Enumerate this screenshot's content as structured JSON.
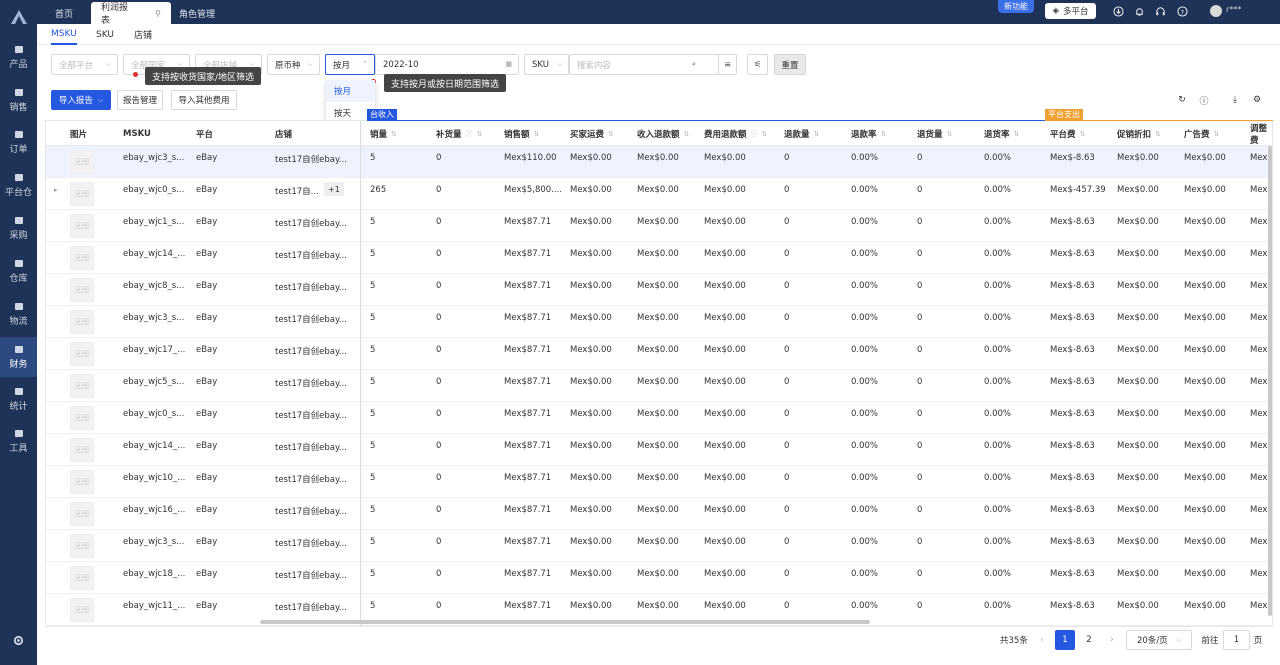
{
  "topbar": {
    "tabs": [
      {
        "label": "首页"
      },
      {
        "label": "利润报表"
      },
      {
        "label": "角色管理"
      }
    ],
    "new_feature": "新功能",
    "multi_platform": "多平台",
    "username": "r***"
  },
  "sidebar": {
    "items": [
      {
        "label": "产品",
        "icon": "product-icon"
      },
      {
        "label": "销售",
        "icon": "sales-icon"
      },
      {
        "label": "订单",
        "icon": "order-icon"
      },
      {
        "label": "平台仓",
        "icon": "platform-warehouse-icon"
      },
      {
        "label": "采购",
        "icon": "purchase-icon"
      },
      {
        "label": "仓库",
        "icon": "warehouse-icon"
      },
      {
        "label": "物流",
        "icon": "logistics-icon"
      },
      {
        "label": "财务",
        "icon": "finance-icon",
        "active": true
      },
      {
        "label": "统计",
        "icon": "stats-icon"
      },
      {
        "label": "工具",
        "icon": "tools-icon"
      }
    ]
  },
  "subtabs": [
    "MSKU",
    "SKU",
    "店铺"
  ],
  "filters": {
    "platform_placeholder": "全部平台",
    "country_placeholder": "全部国家",
    "store_placeholder": "全部店铺",
    "currency": "原币种",
    "period_type": "按月",
    "date": "2022-10",
    "search_type": "SKU",
    "search_placeholder": "搜索内容",
    "reset": "重置"
  },
  "tooltips": {
    "country": "支持按收货国家/地区筛选",
    "period": "支持按月或按日期范围筛选"
  },
  "period_options": [
    "按月",
    "按天"
  ],
  "actions": {
    "import_report": "导入报告",
    "report_manage": "报告管理",
    "import_other": "导入其他费用"
  },
  "groups": {
    "income": "台收入",
    "expense": "平台支出"
  },
  "columns": {
    "image": "图片",
    "msku": "MSKU",
    "platform": "平台",
    "store": "店铺",
    "sales_qty": "销量",
    "restock": "补货量",
    "sales_amount": "销售额",
    "buyer_shipping": "买家运费",
    "income_refund": "收入退款额",
    "fee_refund": "费用退款额",
    "refund_qty": "退款量",
    "refund_rate": "退款率",
    "return_qty": "退货量",
    "return_rate": "退货率",
    "platform_fee": "平台费",
    "promo_discount": "促销折扣",
    "ad_fee": "广告费",
    "adjust_fee": "调整费"
  },
  "no_image": "无图",
  "rows": [
    {
      "msku": "ebay_wjc3_s...",
      "platform": "eBay",
      "store": "test17自创ebay...",
      "sales": "5",
      "restock": "0",
      "amount": "Mex$110.00",
      "ship": "Mex$0.00",
      "inref": "Mex$0.00",
      "feeref": "Mex$0.00",
      "rqty": "0",
      "rrate": "0.00%",
      "retq": "0",
      "retr": "0.00%",
      "pfee": "Mex$-8.63",
      "promo": "Mex$0.00",
      "ad": "Mex$0.00",
      "adj": "Mex"
    },
    {
      "msku": "ebay_wjc0_s...",
      "platform": "eBay",
      "store": "test17自...",
      "badge": "+1",
      "sales": "265",
      "restock": "0",
      "amount": "Mex$5,800....",
      "ship": "Mex$0.00",
      "inref": "Mex$0.00",
      "feeref": "Mex$0.00",
      "rqty": "0",
      "rrate": "0.00%",
      "retq": "0",
      "retr": "0.00%",
      "pfee": "Mex$-457.39",
      "promo": "Mex$0.00",
      "ad": "Mex$0.00",
      "adj": "Mex"
    },
    {
      "msku": "ebay_wjc1_s...",
      "platform": "eBay",
      "store": "test17自创ebay...",
      "sales": "5",
      "restock": "0",
      "amount": "Mex$87.71",
      "ship": "Mex$0.00",
      "inref": "Mex$0.00",
      "feeref": "Mex$0.00",
      "rqty": "0",
      "rrate": "0.00%",
      "retq": "0",
      "retr": "0.00%",
      "pfee": "Mex$-8.63",
      "promo": "Mex$0.00",
      "ad": "Mex$0.00",
      "adj": "Mex"
    },
    {
      "msku": "ebay_wjc14_...",
      "platform": "eBay",
      "store": "test17自创ebay...",
      "sales": "5",
      "restock": "0",
      "amount": "Mex$87.71",
      "ship": "Mex$0.00",
      "inref": "Mex$0.00",
      "feeref": "Mex$0.00",
      "rqty": "0",
      "rrate": "0.00%",
      "retq": "0",
      "retr": "0.00%",
      "pfee": "Mex$-8.63",
      "promo": "Mex$0.00",
      "ad": "Mex$0.00",
      "adj": "Mex"
    },
    {
      "msku": "ebay_wjc8_s...",
      "platform": "eBay",
      "store": "test17自创ebay...",
      "sales": "5",
      "restock": "0",
      "amount": "Mex$87.71",
      "ship": "Mex$0.00",
      "inref": "Mex$0.00",
      "feeref": "Mex$0.00",
      "rqty": "0",
      "rrate": "0.00%",
      "retq": "0",
      "retr": "0.00%",
      "pfee": "Mex$-8.63",
      "promo": "Mex$0.00",
      "ad": "Mex$0.00",
      "adj": "Mex"
    },
    {
      "msku": "ebay_wjc3_s...",
      "platform": "eBay",
      "store": "test17自创ebay...",
      "sales": "5",
      "restock": "0",
      "amount": "Mex$87.71",
      "ship": "Mex$0.00",
      "inref": "Mex$0.00",
      "feeref": "Mex$0.00",
      "rqty": "0",
      "rrate": "0.00%",
      "retq": "0",
      "retr": "0.00%",
      "pfee": "Mex$-8.63",
      "promo": "Mex$0.00",
      "ad": "Mex$0.00",
      "adj": "Mex"
    },
    {
      "msku": "ebay_wjc17_...",
      "platform": "eBay",
      "store": "test17自创ebay...",
      "sales": "5",
      "restock": "0",
      "amount": "Mex$87.71",
      "ship": "Mex$0.00",
      "inref": "Mex$0.00",
      "feeref": "Mex$0.00",
      "rqty": "0",
      "rrate": "0.00%",
      "retq": "0",
      "retr": "0.00%",
      "pfee": "Mex$-8.63",
      "promo": "Mex$0.00",
      "ad": "Mex$0.00",
      "adj": "Mex"
    },
    {
      "msku": "ebay_wjc5_s...",
      "platform": "eBay",
      "store": "test17自创ebay...",
      "sales": "5",
      "restock": "0",
      "amount": "Mex$87.71",
      "ship": "Mex$0.00",
      "inref": "Mex$0.00",
      "feeref": "Mex$0.00",
      "rqty": "0",
      "rrate": "0.00%",
      "retq": "0",
      "retr": "0.00%",
      "pfee": "Mex$-8.63",
      "promo": "Mex$0.00",
      "ad": "Mex$0.00",
      "adj": "Mex"
    },
    {
      "msku": "ebay_wjc0_s...",
      "platform": "eBay",
      "store": "test17自创ebay...",
      "sales": "5",
      "restock": "0",
      "amount": "Mex$87.71",
      "ship": "Mex$0.00",
      "inref": "Mex$0.00",
      "feeref": "Mex$0.00",
      "rqty": "0",
      "rrate": "0.00%",
      "retq": "0",
      "retr": "0.00%",
      "pfee": "Mex$-8.63",
      "promo": "Mex$0.00",
      "ad": "Mex$0.00",
      "adj": "Mex"
    },
    {
      "msku": "ebay_wjc14_...",
      "platform": "eBay",
      "store": "test17自创ebay...",
      "sales": "5",
      "restock": "0",
      "amount": "Mex$87.71",
      "ship": "Mex$0.00",
      "inref": "Mex$0.00",
      "feeref": "Mex$0.00",
      "rqty": "0",
      "rrate": "0.00%",
      "retq": "0",
      "retr": "0.00%",
      "pfee": "Mex$-8.63",
      "promo": "Mex$0.00",
      "ad": "Mex$0.00",
      "adj": "Mex"
    },
    {
      "msku": "ebay_wjc10_...",
      "platform": "eBay",
      "store": "test17自创ebay...",
      "sales": "5",
      "restock": "0",
      "amount": "Mex$87.71",
      "ship": "Mex$0.00",
      "inref": "Mex$0.00",
      "feeref": "Mex$0.00",
      "rqty": "0",
      "rrate": "0.00%",
      "retq": "0",
      "retr": "0.00%",
      "pfee": "Mex$-8.63",
      "promo": "Mex$0.00",
      "ad": "Mex$0.00",
      "adj": "Mex"
    },
    {
      "msku": "ebay_wjc16_...",
      "platform": "eBay",
      "store": "test17自创ebay...",
      "sales": "5",
      "restock": "0",
      "amount": "Mex$87.71",
      "ship": "Mex$0.00",
      "inref": "Mex$0.00",
      "feeref": "Mex$0.00",
      "rqty": "0",
      "rrate": "0.00%",
      "retq": "0",
      "retr": "0.00%",
      "pfee": "Mex$-8.63",
      "promo": "Mex$0.00",
      "ad": "Mex$0.00",
      "adj": "Mex"
    },
    {
      "msku": "ebay_wjc3_s...",
      "platform": "eBay",
      "store": "test17自创ebay...",
      "sales": "5",
      "restock": "0",
      "amount": "Mex$87.71",
      "ship": "Mex$0.00",
      "inref": "Mex$0.00",
      "feeref": "Mex$0.00",
      "rqty": "0",
      "rrate": "0.00%",
      "retq": "0",
      "retr": "0.00%",
      "pfee": "Mex$-8.63",
      "promo": "Mex$0.00",
      "ad": "Mex$0.00",
      "adj": "Mex"
    },
    {
      "msku": "ebay_wjc18_...",
      "platform": "eBay",
      "store": "test17自创ebay...",
      "sales": "5",
      "restock": "0",
      "amount": "Mex$87.71",
      "ship": "Mex$0.00",
      "inref": "Mex$0.00",
      "feeref": "Mex$0.00",
      "rqty": "0",
      "rrate": "0.00%",
      "retq": "0",
      "retr": "0.00%",
      "pfee": "Mex$-8.63",
      "promo": "Mex$0.00",
      "ad": "Mex$0.00",
      "adj": "Mex"
    },
    {
      "msku": "ebay_wjc11_...",
      "platform": "eBay",
      "store": "test17自创ebay...",
      "sales": "5",
      "restock": "0",
      "amount": "Mex$87.71",
      "ship": "Mex$0.00",
      "inref": "Mex$0.00",
      "feeref": "Mex$0.00",
      "rqty": "0",
      "rrate": "0.00%",
      "retq": "0",
      "retr": "0.00%",
      "pfee": "Mex$-8.63",
      "promo": "Mex$0.00",
      "ad": "Mex$0.00",
      "adj": "Mex"
    }
  ],
  "pager": {
    "total": "共35条",
    "page1": "1",
    "page2": "2",
    "page_size": "20条/页",
    "goto_label": "前往",
    "goto_value": "1",
    "page_unit": "页"
  },
  "colors": {
    "accent": "#2558e0",
    "sidebar": "#1f3358",
    "income_group": "#2558e0",
    "expense_group": "#f0a030"
  }
}
